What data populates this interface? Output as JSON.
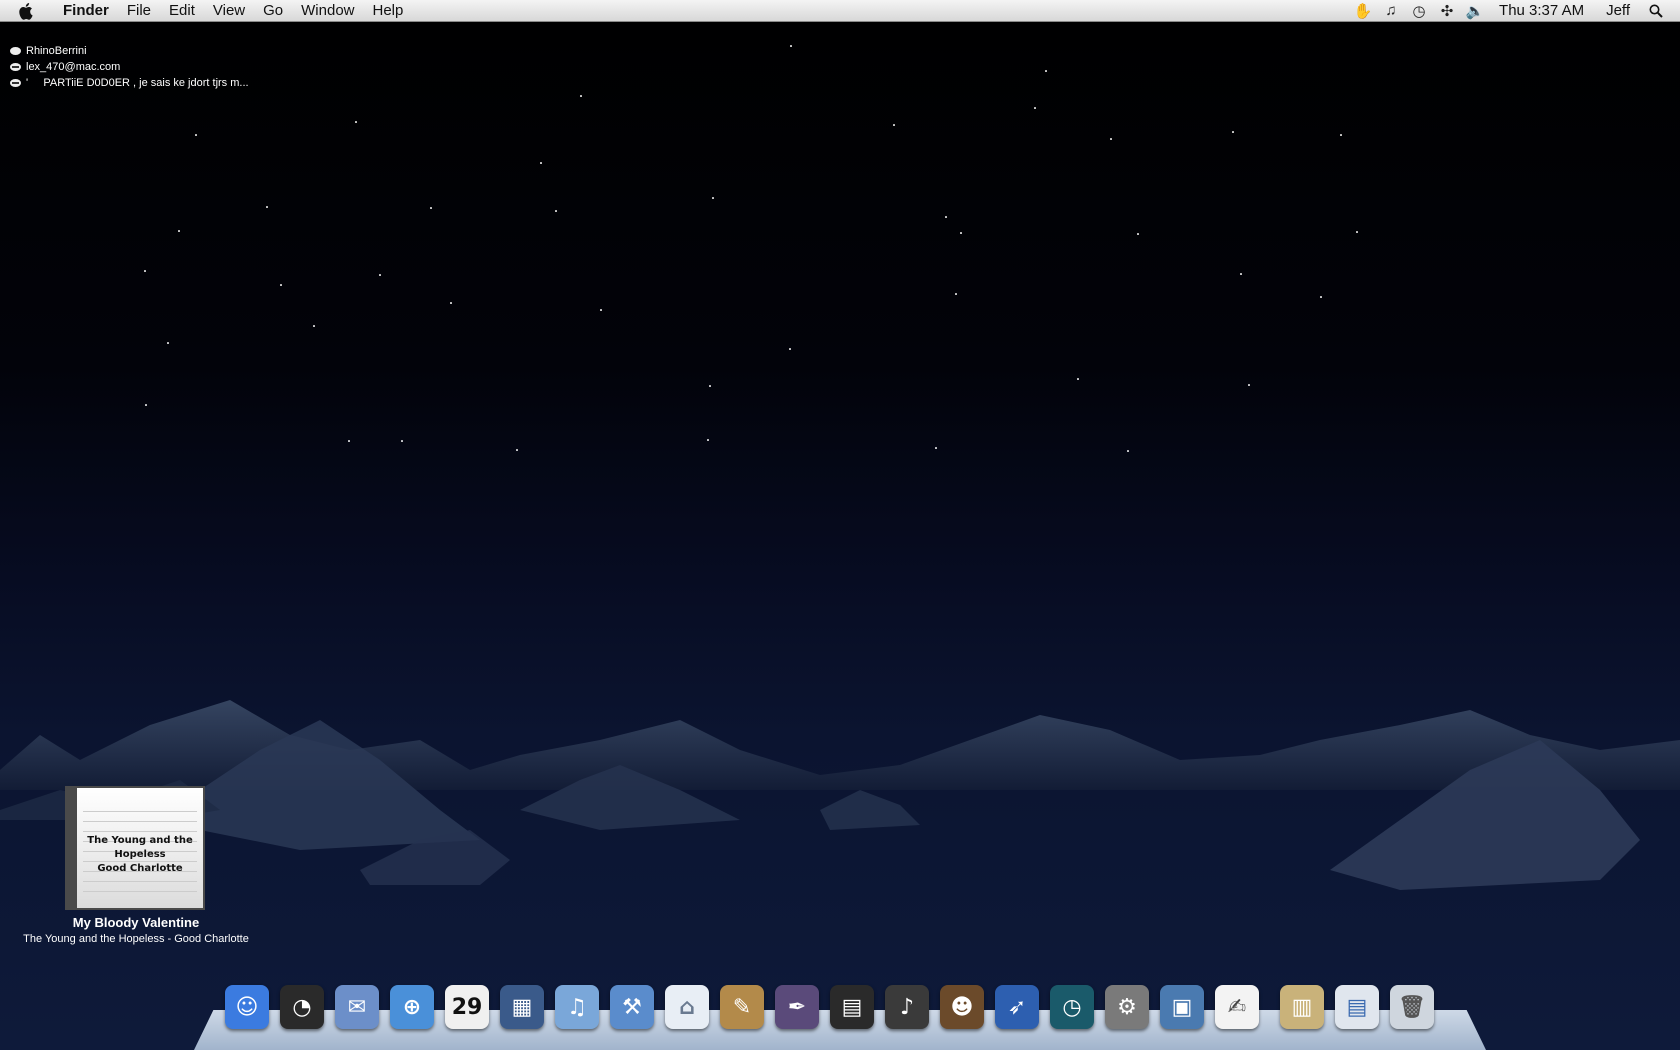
{
  "menubar": {
    "app_name": "Finder",
    "menus": [
      "File",
      "Edit",
      "View",
      "Go",
      "Window",
      "Help"
    ],
    "status_icons": [
      "growl-icon",
      "music-note-icon",
      "time-machine-icon",
      "bluetooth-icon",
      "volume-icon"
    ],
    "clock": "Thu 3:37 AM",
    "user": "Jeff"
  },
  "buddies": [
    {
      "name": "RhinoBerrini",
      "status": "available"
    },
    {
      "name": "lex_470@mac.com",
      "status": "away"
    },
    {
      "name": "'     PARTiiE D0D0ER , je sais ke jdort tjrs m...",
      "status": "away"
    }
  ],
  "now_playing": {
    "cover_text_line1": "The Young and the Hopeless",
    "cover_text_line2": "Good Charlotte",
    "track": "My Bloody Valentine",
    "album_artist": "The Young and the Hopeless - Good Charlotte"
  },
  "dock": [
    {
      "name": "finder",
      "color": "#3b7be0",
      "glyph": "☺"
    },
    {
      "name": "dashboard",
      "color": "#2a2a2a",
      "glyph": "◔"
    },
    {
      "name": "mail",
      "color": "#6c8fc9",
      "glyph": "✉"
    },
    {
      "name": "safari",
      "color": "#4a90d9",
      "glyph": "⊕"
    },
    {
      "name": "ical",
      "color": "#f0f0f0",
      "glyph": "29",
      "text_color": "#111"
    },
    {
      "name": "spaces",
      "color": "#3a5a8a",
      "glyph": "▦"
    },
    {
      "name": "itunes",
      "color": "#7aa7d9",
      "glyph": "♫"
    },
    {
      "name": "xcode",
      "color": "#5a8ccc",
      "glyph": "⚒"
    },
    {
      "name": "igloo",
      "color": "#e8eef5",
      "glyph": "⌂",
      "text_color": "#6a7a90"
    },
    {
      "name": "evernote",
      "color": "#b38a4a",
      "glyph": "✎"
    },
    {
      "name": "quill",
      "color": "#5a4a7a",
      "glyph": "✒"
    },
    {
      "name": "imovie",
      "color": "#2a2a2a",
      "glyph": "▤"
    },
    {
      "name": "garageband",
      "color": "#3a3a3a",
      "glyph": "♪"
    },
    {
      "name": "monkey",
      "color": "#6b4a2a",
      "glyph": "☻"
    },
    {
      "name": "feather",
      "color": "#2d5fb0",
      "glyph": "➶"
    },
    {
      "name": "time-machine",
      "color": "#1a5a6a",
      "glyph": "◷"
    },
    {
      "name": "system-preferences",
      "color": "#7a7a7a",
      "glyph": "⚙"
    },
    {
      "name": "iphoto",
      "color": "#4a7ab0",
      "glyph": "▣"
    },
    {
      "name": "textedit",
      "color": "#f3f3f3",
      "glyph": "✍",
      "text_color": "#444"
    },
    {
      "name": "separator"
    },
    {
      "name": "documents-stack",
      "color": "#c9b27a",
      "glyph": "▥"
    },
    {
      "name": "downloads-stack",
      "color": "#e0e6ee",
      "glyph": "▤",
      "text_color": "#3a6ab0"
    },
    {
      "name": "trash",
      "color": "#cfd6de",
      "glyph": "🗑",
      "text_color": "#555"
    }
  ]
}
